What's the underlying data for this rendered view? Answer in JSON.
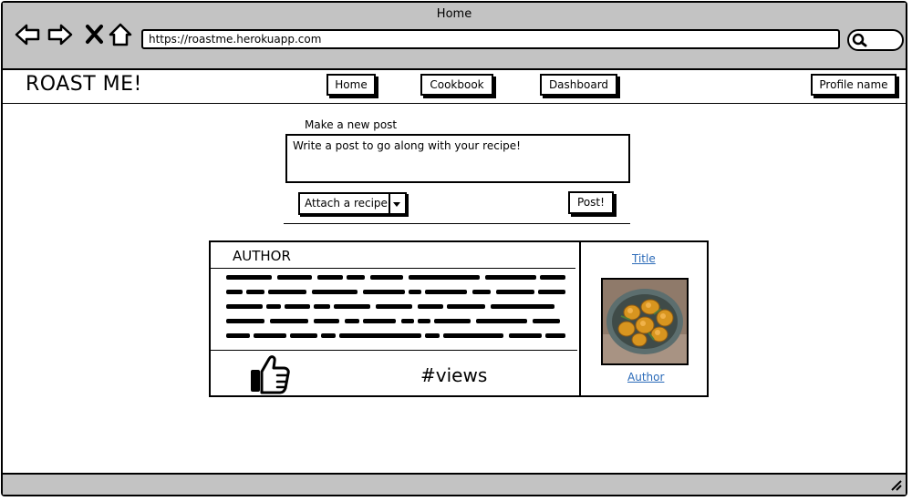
{
  "window": {
    "title": "Home"
  },
  "browser": {
    "url": "https://roastme.herokuapp.com"
  },
  "app": {
    "logo": "ROAST ME!"
  },
  "nav": {
    "home": "Home",
    "cookbook": "Cookbook",
    "dashboard": "Dashboard",
    "profile": "Profile name"
  },
  "composer": {
    "heading": "Make a new post",
    "placeholder": "Write a post to go along with your recipe!",
    "attach_label": "Attach a recipe",
    "post_button": "Post!"
  },
  "post": {
    "author": "AUTHOR",
    "views": "#views",
    "recipe_title": "Title",
    "recipe_author": "Author"
  },
  "colors": {
    "chrome": "#c3c3c3",
    "link": "#2a6ab8"
  },
  "icons": [
    "back-arrow-icon",
    "forward-arrow-icon",
    "close-x-icon",
    "home-icon",
    "search-icon",
    "thumbs-up-icon",
    "resize-grip-icon"
  ]
}
